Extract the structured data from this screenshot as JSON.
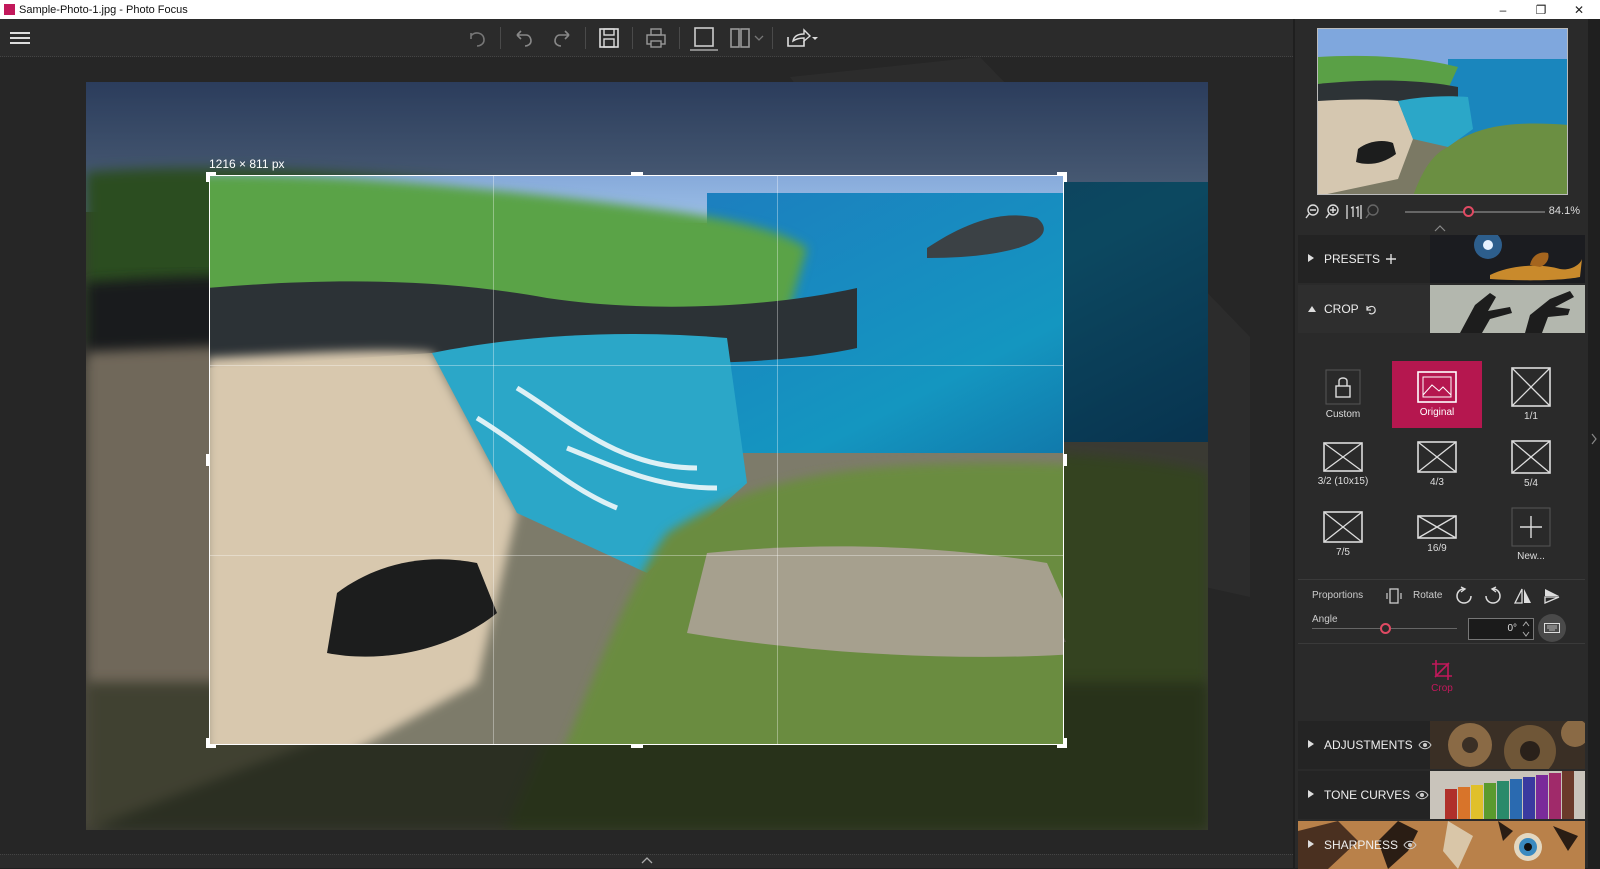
{
  "window": {
    "title": "Sample-Photo-1.jpg - Photo Focus",
    "minimize": "–",
    "restore": "❐",
    "close": "✕"
  },
  "canvas": {
    "crop_size": "1216 × 811 px"
  },
  "navigator": {
    "zoom_percent": "84.1%",
    "zoom_level": 0.45
  },
  "panels": {
    "presets": {
      "label": "PRESETS"
    },
    "crop": {
      "label": "CROP"
    },
    "adjustments": {
      "label": "ADJUSTMENTS"
    },
    "tone_curves": {
      "label": "TONE CURVES"
    },
    "sharpness": {
      "label": "SHARPNESS"
    }
  },
  "crop_ratios": [
    {
      "label": "Custom",
      "icon": "lock-icon",
      "active": false
    },
    {
      "label": "Original",
      "icon": "image-icon",
      "active": true
    },
    {
      "label": "1/1",
      "icon": "ratio-icon",
      "active": false
    },
    {
      "label": "3/2 (10x15)",
      "icon": "ratio-icon",
      "active": false
    },
    {
      "label": "4/3",
      "icon": "ratio-icon",
      "active": false
    },
    {
      "label": "5/4",
      "icon": "ratio-icon",
      "active": false
    },
    {
      "label": "7/5",
      "icon": "ratio-icon",
      "active": false
    },
    {
      "label": "16/9",
      "icon": "ratio-icon",
      "active": false
    },
    {
      "label": "New...",
      "icon": "plus-icon",
      "active": false
    }
  ],
  "crop_options": {
    "proportions_label": "Proportions",
    "rotate_label": "Rotate",
    "angle_label": "Angle",
    "angle_value": "0°",
    "angle_slider": 0.5,
    "crop_button": "Crop"
  },
  "colors": {
    "accent": "#b5174f",
    "knob": "#e04a63",
    "panel": "#2a2a2a",
    "toolbar": "#2b2b2b"
  }
}
